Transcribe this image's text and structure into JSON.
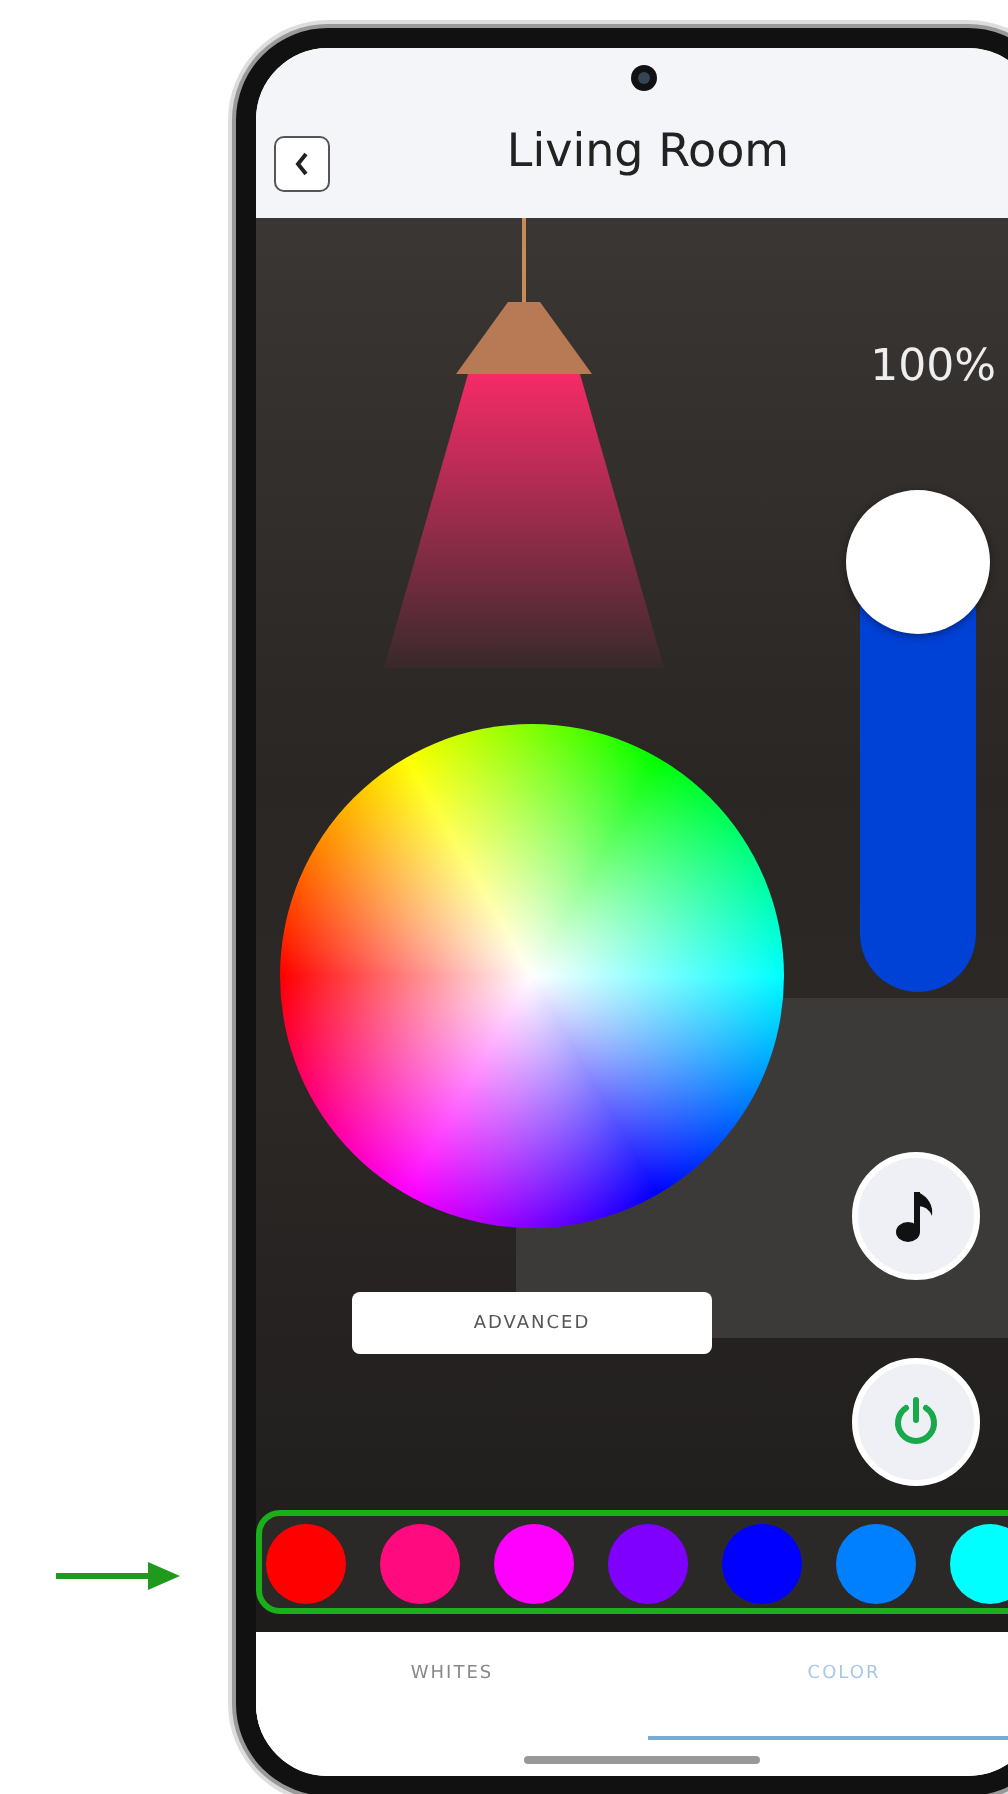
{
  "header": {
    "title": "Living Room"
  },
  "brightness": {
    "reading": "100%",
    "level": 1
  },
  "advanced_button": {
    "label": "ADVANCED"
  },
  "swatches": [
    {
      "color": "#ff0000"
    },
    {
      "color": "#ff0a7f"
    },
    {
      "color": "#ff00ff"
    },
    {
      "color": "#8000ff"
    },
    {
      "color": "#0000ff"
    },
    {
      "color": "#0080ff"
    },
    {
      "color": "#00ffff"
    }
  ],
  "tabs": [
    {
      "label": "WHITES",
      "selected": false
    },
    {
      "label": "COLOR",
      "selected": true
    }
  ]
}
